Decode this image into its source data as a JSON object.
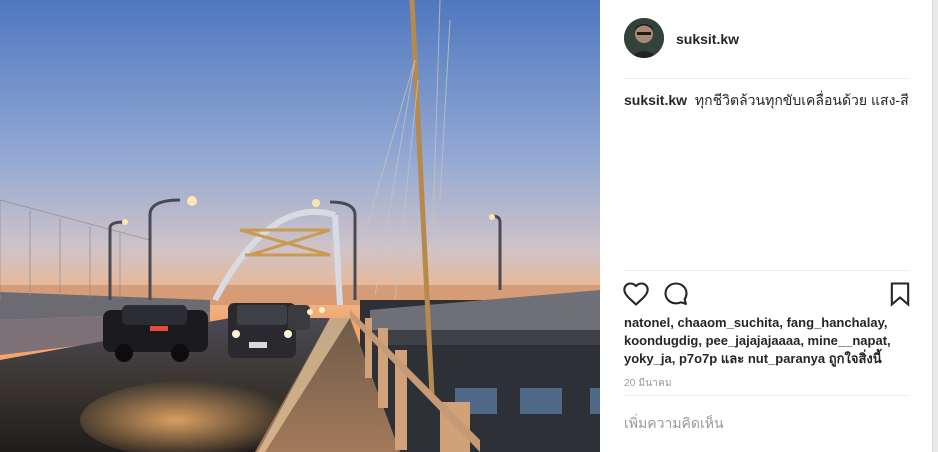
{
  "post": {
    "username": "suksit.kw",
    "caption_user": "suksit.kw",
    "caption_text": "ทุกชีวิตล้วนทุกขับเคลื่อนด้วย แสง-สี",
    "likes": {
      "names": [
        "natonel",
        "chaaom_suchita",
        "fang_hanchalay",
        "koondugdig",
        "pee_jajajajaaaa",
        "mine__napat",
        "yoky_ja",
        "p7o7p"
      ],
      "and_word": "และ",
      "last_name": "nut_paranya",
      "suffix": "ถูกใจสิ่งนี้"
    },
    "date": "20 มีนาคม",
    "comment_placeholder": "เพิ่มความคิดเห็น"
  },
  "icons": {
    "like": "heart-icon",
    "comment": "comment-bubble-icon",
    "save": "bookmark-icon"
  },
  "colors": {
    "text": "#262626",
    "muted": "#999999",
    "divider": "#efefef"
  }
}
